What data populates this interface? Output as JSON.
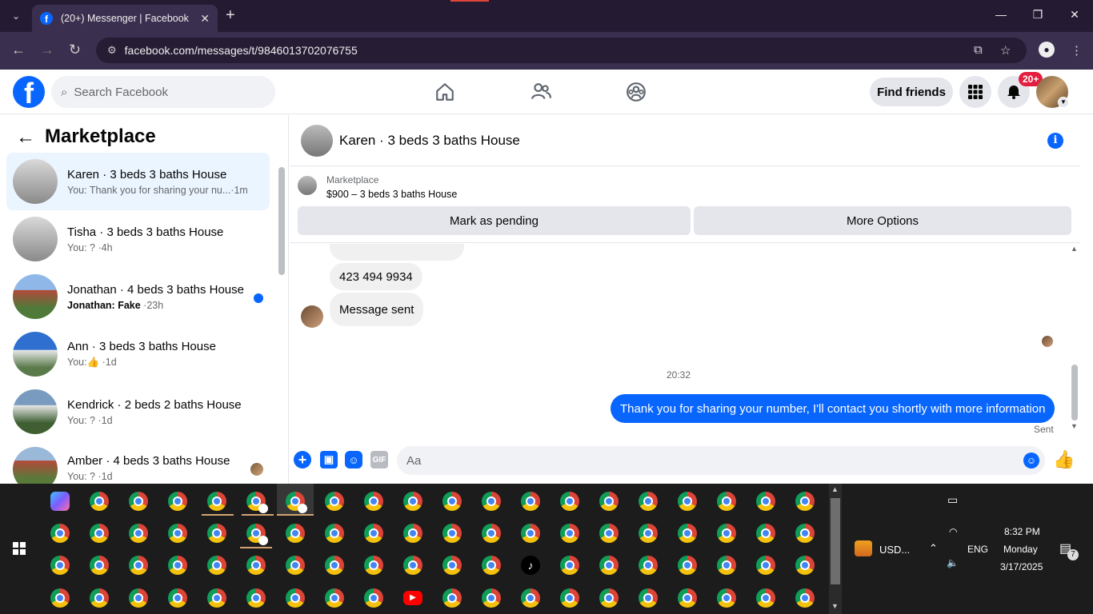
{
  "browser": {
    "tab_title": "(20+) Messenger | Facebook",
    "url": "facebook.com/messages/t/9846013702076755"
  },
  "header": {
    "search_placeholder": "Search Facebook",
    "find_friends": "Find friends",
    "notification_badge": "20+"
  },
  "sidebar": {
    "title": "Marketplace",
    "conversations": [
      {
        "name": "Karen · 3 beds 3 baths House",
        "preview": "You: Thank you for sharing your nu...",
        "time": "1m",
        "active": true
      },
      {
        "name": "Tisha · 3 beds 3 baths House",
        "preview": "You: ?",
        "time": "4h"
      },
      {
        "name": "Jonathan · 4 beds 3 baths House",
        "preview_sender": "Jonathan: Fake",
        "time": "23h",
        "unread": true
      },
      {
        "name": "Ann · 3 beds 3 baths House",
        "preview": "You:",
        "time": "1d"
      },
      {
        "name": "Kendrick · 2 beds 2 baths House",
        "preview": "You: ?",
        "time": "1d"
      },
      {
        "name": "Amber · 4 beds 3 baths House",
        "preview": "You: ?",
        "time": "1d"
      }
    ]
  },
  "chat": {
    "title": "Karen · 3 beds 3 baths House",
    "listing_category": "Marketplace",
    "listing_price": "$900 – 3 beds 3 baths House",
    "mark_pending": "Mark as pending",
    "more_options": "More Options",
    "messages": {
      "phone": "423 494 9934",
      "sent_note": "Message sent",
      "timestamp": "20:32",
      "outgoing": "Thank you for sharing your number, I'll contact you shortly with more information",
      "status": "Sent"
    },
    "composer_placeholder": "Aa"
  },
  "tray": {
    "usd": "USD...",
    "lang": "ENG",
    "time": "8:32 PM",
    "day": "Monday",
    "date": "3/17/2025",
    "notif_count": "7"
  },
  "colors": {
    "facebook_blue": "#0866ff",
    "active_row": "#ebf5ff",
    "badge_red": "#e41e3f"
  }
}
